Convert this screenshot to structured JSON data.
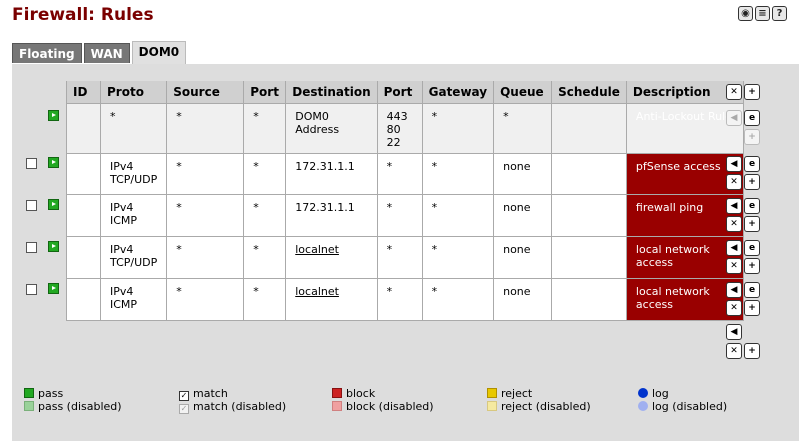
{
  "page_title": "Firewall: Rules",
  "top_icons": [
    "status-icon",
    "list-icon",
    "help-icon"
  ],
  "tabs": [
    {
      "label": "Floating",
      "active": false
    },
    {
      "label": "WAN",
      "active": false
    },
    {
      "label": "DOM0",
      "active": true
    }
  ],
  "table": {
    "headers": [
      "ID",
      "Proto",
      "Source",
      "Port",
      "Destination",
      "Port",
      "Gateway",
      "Queue",
      "Schedule",
      "Description"
    ],
    "rows": [
      {
        "id": "",
        "proto": "*",
        "source": "*",
        "port": "*",
        "destination": "DOM0 Address",
        "dest_port": "443\n80\n22",
        "gateway": "*",
        "queue": "*",
        "schedule": "",
        "description": "Anti-Lockout Rule"
      },
      {
        "id": "",
        "proto": "IPv4\nTCP/UDP",
        "source": "*",
        "port": "*",
        "destination": "172.31.1.1",
        "dest_port": "*",
        "gateway": "*",
        "queue": "none",
        "schedule": "",
        "description": "pfSense access"
      },
      {
        "id": "",
        "proto": "IPv4\nICMP",
        "source": "*",
        "port": "*",
        "destination": "172.31.1.1",
        "dest_port": "*",
        "gateway": "*",
        "queue": "none",
        "schedule": "",
        "description": "firewall ping"
      },
      {
        "id": "",
        "proto": "IPv4\nTCP/UDP",
        "source": "*",
        "port": "*",
        "destination": "localnet",
        "dest_port": "*",
        "gateway": "*",
        "queue": "none",
        "schedule": "",
        "description": "local network\naccess"
      },
      {
        "id": "",
        "proto": "IPv4\nICMP",
        "source": "*",
        "port": "*",
        "destination": "localnet",
        "dest_port": "*",
        "gateway": "*",
        "queue": "none",
        "schedule": "",
        "description": "local network\naccess"
      }
    ]
  },
  "legend": {
    "pass": "pass",
    "pass_disabled": "pass (disabled)",
    "match": "match",
    "match_disabled": "match (disabled)",
    "block": "block",
    "block_disabled": "block (disabled)",
    "reject": "reject",
    "reject_disabled": "reject (disabled)",
    "log": "log",
    "log_disabled": "log (disabled)"
  },
  "colors": {
    "title": "#7a0000",
    "description_bg": "#990000",
    "pass": "#22a822",
    "block": "#cc2222",
    "reject": "#e8c800",
    "log": "#0033cc"
  }
}
